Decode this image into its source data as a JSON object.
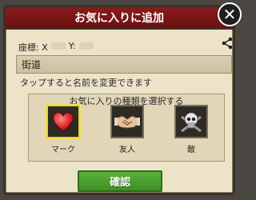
{
  "dialog": {
    "title": "お気に入りに追加",
    "coords": {
      "x_label": "座標: X",
      "y_label": "Y:"
    },
    "name_value": "街道",
    "hint": "タップすると名前を変更できます",
    "type_heading": "お気に入りの種類を選択する",
    "options": [
      {
        "label": "マーク",
        "icon": "heart-icon",
        "selected": true
      },
      {
        "label": "友人",
        "icon": "handshake-icon",
        "selected": false
      },
      {
        "label": "敵",
        "icon": "skull-icon",
        "selected": false
      }
    ],
    "confirm_label": "確認"
  },
  "colors": {
    "title_bar": "#7a1515",
    "dialog_bg": "#ece3c9",
    "confirm_button": "#4da02f",
    "selected_outline": "#e8d23a"
  }
}
